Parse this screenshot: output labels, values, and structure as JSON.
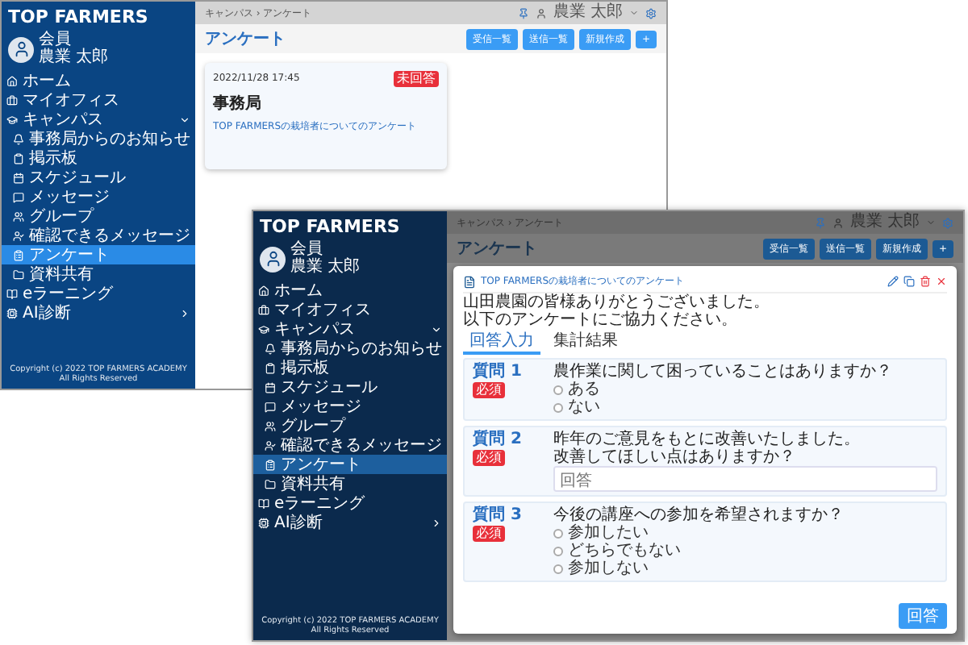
{
  "windows": [
    {
      "kind": "list",
      "brand": "TOP FARMERS",
      "user": {
        "role": "会員",
        "name": "農業 太郎"
      },
      "sidebar": {
        "items": [
          {
            "label": "ホーム",
            "selected": false
          },
          {
            "label": "マイオフィス",
            "selected": false
          },
          {
            "label": "キャンパス",
            "selected": false,
            "expanded": true,
            "children": [
              {
                "label": "事務局からのお知らせ",
                "selected": false
              },
              {
                "label": "掲示板",
                "selected": false
              },
              {
                "label": "スケジュール",
                "selected": false
              },
              {
                "label": "メッセージ",
                "selected": false
              },
              {
                "label": "グループ",
                "selected": false
              },
              {
                "label": "確認できるメッセージ",
                "selected": false
              },
              {
                "label": "アンケート",
                "selected": true
              },
              {
                "label": "資料共有",
                "selected": false
              }
            ]
          },
          {
            "label": "eラーニング",
            "selected": false
          },
          {
            "label": "AI診断",
            "selected": false,
            "expanded": false
          }
        ]
      },
      "copyright": "Copyright (c) 2022 TOP FARMERS ACADEMY All Rights Reserved",
      "breadcrumb": "キャンパス › アンケート",
      "header_user": "農業 太郎",
      "page_title": "アンケート",
      "actions": [
        "受信一覧",
        "送信一覧",
        "新規作成",
        "+"
      ],
      "cards": [
        {
          "date": "2022/11/28 17:45",
          "badge": "未回答",
          "sender": "事務局",
          "title": "TOP FARMERSの栽培者についてのアンケート"
        }
      ]
    },
    {
      "kind": "detail",
      "brand": "TOP FARMERS",
      "user": {
        "role": "会員",
        "name": "農業 太郎"
      },
      "sidebar": {
        "items": [
          {
            "label": "ホーム",
            "selected": false
          },
          {
            "label": "マイオフィス",
            "selected": false
          },
          {
            "label": "キャンパス",
            "selected": false,
            "expanded": true,
            "children": [
              {
                "label": "事務局からのお知らせ",
                "selected": false
              },
              {
                "label": "掲示板",
                "selected": false
              },
              {
                "label": "スケジュール",
                "selected": false
              },
              {
                "label": "メッセージ",
                "selected": false
              },
              {
                "label": "グループ",
                "selected": false
              },
              {
                "label": "確認できるメッセージ",
                "selected": false
              },
              {
                "label": "アンケート",
                "selected": true
              },
              {
                "label": "資料共有",
                "selected": false
              }
            ]
          },
          {
            "label": "eラーニング",
            "selected": false
          },
          {
            "label": "AI診断",
            "selected": false,
            "expanded": false
          }
        ]
      },
      "copyright": "Copyright (c) 2022 TOP FARMERS ACADEMY All Rights Reserved",
      "breadcrumb": "キャンパス › アンケート",
      "header_user": "農業 太郎",
      "page_title": "アンケート",
      "actions": [
        "受信一覧",
        "送信一覧",
        "新規作成",
        "+"
      ],
      "modal": {
        "title": "TOP FARMERSの栽培者についてのアンケート",
        "intro": [
          "山田農園の皆様ありがとうございました。",
          "以下のアンケートにご協力ください。"
        ],
        "tabs": [
          {
            "label": "回答入力",
            "selected": true
          },
          {
            "label": "集計結果",
            "selected": false
          }
        ],
        "questions": [
          {
            "kind": "choice",
            "label": "質問 1",
            "badge": "必須",
            "text": [
              "農作業に関して困っていることはありますか？"
            ],
            "options": [
              {
                "label": "ある",
                "selected": false
              },
              {
                "label": "ない",
                "selected": false
              }
            ]
          },
          {
            "kind": "text",
            "label": "質問 2",
            "badge": "必須",
            "text": [
              "昨年のご意見をもとに改善いたしました。",
              "改善してほしい点はありますか？"
            ],
            "placeholder": "回答"
          },
          {
            "kind": "choice",
            "label": "質問 3",
            "badge": "必須",
            "text": [
              "今後の講座への参加を希望されますか？"
            ],
            "options": [
              {
                "label": "参加したい",
                "selected": false
              },
              {
                "label": "どちらでもない",
                "selected": false
              },
              {
                "label": "参加しない",
                "selected": false
              }
            ]
          }
        ],
        "submit": "回答"
      }
    }
  ]
}
